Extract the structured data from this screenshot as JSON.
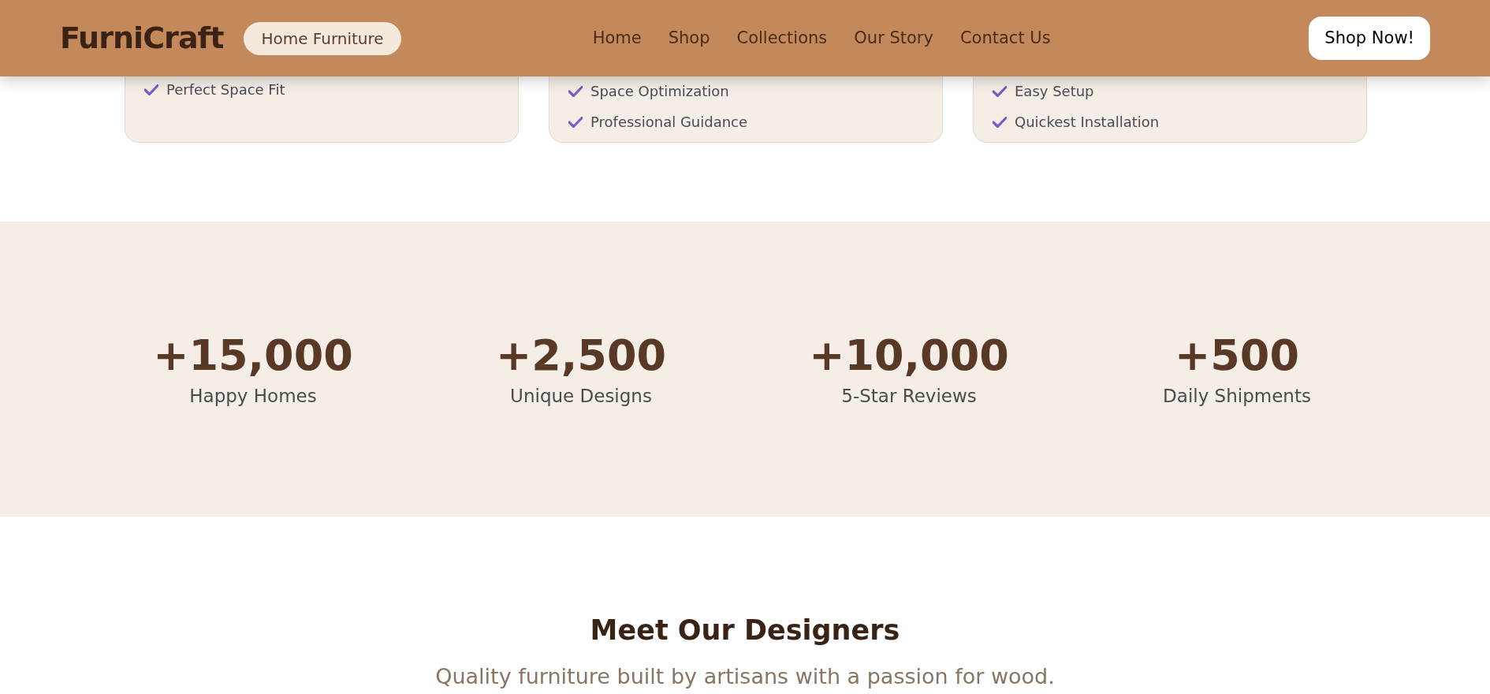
{
  "header": {
    "logo": "FurniCraft",
    "badge": "Home Furniture",
    "nav": [
      "Home",
      "Shop",
      "Collections",
      "Our Story",
      "Contact Us"
    ],
    "cta": "Shop Now!"
  },
  "feature_cards": [
    {
      "items": [
        "Perfect Space Fit"
      ]
    },
    {
      "items": [
        "Space Optimization",
        "Professional Guidance"
      ]
    },
    {
      "items": [
        "Easy Setup",
        "Quickest Installation"
      ]
    }
  ],
  "stats": [
    {
      "value": "+15,000",
      "label": "Happy Homes"
    },
    {
      "value": "+2,500",
      "label": "Unique Designs"
    },
    {
      "value": "+10,000",
      "label": "5-Star Reviews"
    },
    {
      "value": "+500",
      "label": "Daily Shipments"
    }
  ],
  "designers": {
    "title": "Meet Our Designers",
    "subtitle": "Quality furniture built by artisans with a passion for wood."
  }
}
